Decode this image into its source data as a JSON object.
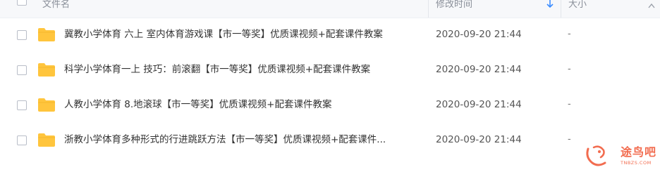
{
  "header": {
    "name_label": "文件名",
    "time_label": "修改时间",
    "size_label": "大小"
  },
  "files": [
    {
      "name": "冀教小学体育 六上 室内体育游戏课【市一等奖】优质课视频+配套课件教案",
      "modified": "2020-09-20 21:44",
      "size": "-"
    },
    {
      "name": "科学小学体育一上 技巧：前滚翻【市一等奖】优质课视频+配套课件教案",
      "modified": "2020-09-20 21:44",
      "size": "-"
    },
    {
      "name": "人教小学体育 8.地滚球【市一等奖】优质课视频+配套课件教案",
      "modified": "2020-09-20 21:44",
      "size": "-"
    },
    {
      "name": "浙教小学体育多种形式的行进跳跃方法【市一等奖】优质课视频+配套课件...",
      "modified": "2020-09-20 21:44",
      "size": "-"
    }
  ],
  "watermark": {
    "text": "途鸟吧",
    "subtext": "TNBZS.COM"
  },
  "colors": {
    "folder": "#ffc53d",
    "sort_arrow": "#3b8cff",
    "watermark": "#f26c4f"
  }
}
